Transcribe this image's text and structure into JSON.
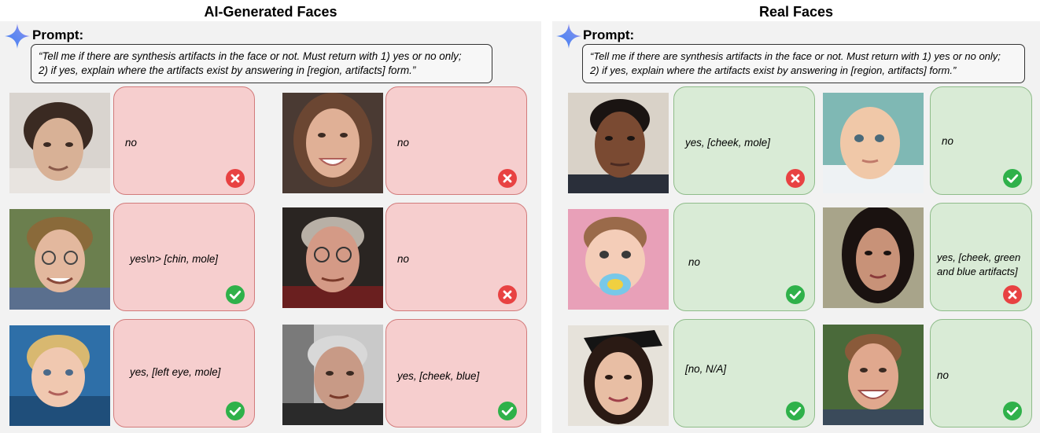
{
  "titles": {
    "left": "AI-Generated Faces",
    "right": "Real Faces"
  },
  "prompt": {
    "label": "Prompt:",
    "text": "“Tell me if there are synthesis artifacts in the face or not. Must return with 1) yes or no only;\n2) if yes, explain where the artifacts exist by answering in [region, artifacts] form.”"
  },
  "colors": {
    "ai_bubble": "#f6cece",
    "real_bubble": "#d9ebd6",
    "correct": "#2fb14a",
    "wrong": "#e84242",
    "star_blue": "#4a7bf0",
    "star_purple": "#a872e8"
  },
  "ai_items": [
    {
      "answer": "no",
      "result": "wrong",
      "icon": "x-mark-icon"
    },
    {
      "answer": "no",
      "result": "wrong",
      "icon": "x-mark-icon"
    },
    {
      "answer": "yes\\n> [chin, mole]",
      "result": "correct",
      "icon": "check-mark-icon"
    },
    {
      "answer": "no",
      "result": "wrong",
      "icon": "x-mark-icon"
    },
    {
      "answer": "yes, [left eye, mole]",
      "result": "correct",
      "icon": "check-mark-icon"
    },
    {
      "answer": "yes, [cheek, blue]",
      "result": "correct",
      "icon": "check-mark-icon"
    }
  ],
  "real_items": [
    {
      "answer": "yes, [cheek, mole]",
      "result": "wrong",
      "icon": "x-mark-icon"
    },
    {
      "answer": "no",
      "result": "correct",
      "icon": "check-mark-icon"
    },
    {
      "answer": "no",
      "result": "correct",
      "icon": "check-mark-icon"
    },
    {
      "answer": "yes, [cheek, green and blue artifacts]",
      "result": "wrong",
      "icon": "x-mark-icon"
    },
    {
      "answer": "[no, N/A]",
      "result": "correct",
      "icon": "check-mark-icon"
    },
    {
      "answer": "no",
      "result": "correct",
      "icon": "check-mark-icon"
    }
  ]
}
